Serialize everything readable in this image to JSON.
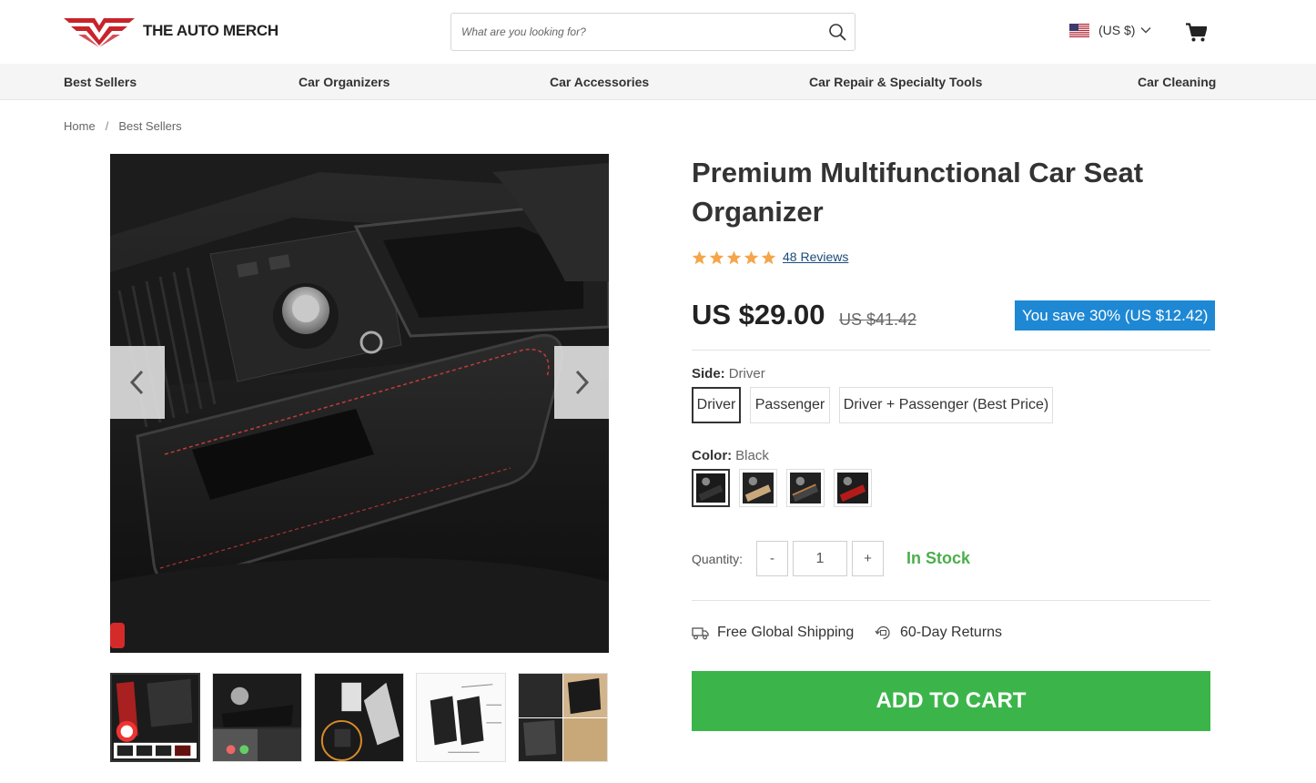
{
  "header": {
    "brand": "THE AUTO MERCH",
    "search_placeholder": "What are you looking for?",
    "currency": "(US $)"
  },
  "nav": {
    "items": [
      "Best Sellers",
      "Car Organizers",
      "Car Accessories",
      "Car Repair & Specialty Tools",
      "Car Cleaning"
    ]
  },
  "breadcrumb": {
    "home": "Home",
    "separator": "/",
    "current": "Best Sellers"
  },
  "product": {
    "title": "Premium Multifunctional Car Seat Organizer",
    "rating": 5,
    "reviews": "48 Reviews",
    "price": "US $29.00",
    "old_price": "US $41.42",
    "save": "You save 30% (US $12.42)",
    "side": {
      "label": "Side:",
      "selected": "Driver",
      "options": [
        "Driver",
        "Passenger",
        "Driver + Passenger (Best Price)"
      ]
    },
    "color": {
      "label": "Color:",
      "selected": "Black",
      "swatches": [
        "black",
        "black-beige",
        "black-tan",
        "black-red"
      ]
    },
    "quantity": {
      "label": "Quantity:",
      "value": "1",
      "minus": "-",
      "plus": "+"
    },
    "stock": "In Stock",
    "perks": [
      "Free Global Shipping",
      "60-Day Returns"
    ],
    "add_to_cart": "ADD TO CART"
  },
  "colors": {
    "accent_green": "#3bb54a",
    "badge_blue": "#1e88d4",
    "star_orange": "#f5a54a",
    "brand_red": "#c8232c"
  }
}
